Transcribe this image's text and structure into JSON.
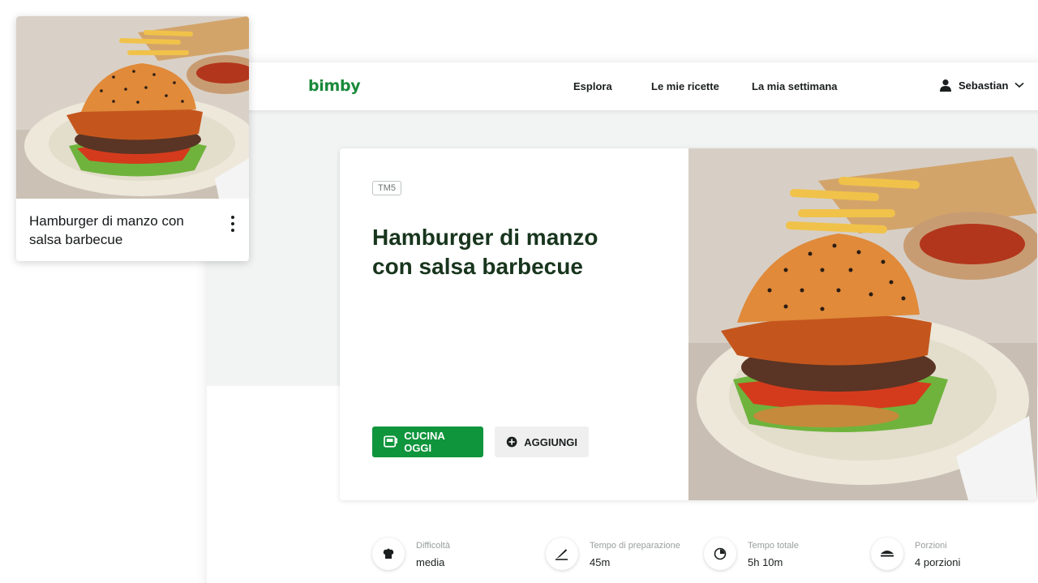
{
  "header": {
    "logo": "bimby",
    "nav": [
      "Esplora",
      "Le mie ricette",
      "La mia settimana"
    ],
    "user_name": "Sebastian"
  },
  "recipe": {
    "badge": "TM5",
    "title": "Hamburger di manzo con salsa barbecue",
    "cook_button": "CUCINA OGGI",
    "add_button": "AGGIUNGI"
  },
  "stats": [
    {
      "label": "Difficoltà",
      "value": "media",
      "icon": "chef-hat-icon"
    },
    {
      "label": "Tempo di preparazione",
      "value": "45m",
      "icon": "knife-icon"
    },
    {
      "label": "Tempo totale",
      "value": "5h 10m",
      "icon": "timer-icon"
    },
    {
      "label": "Porzioni",
      "value": "4 porzioni",
      "icon": "servings-icon"
    }
  ],
  "card": {
    "title": "Hamburger di manzo con salsa barbecue"
  },
  "colors": {
    "brand_green": "#0f953c",
    "title_green": "#18351d"
  }
}
